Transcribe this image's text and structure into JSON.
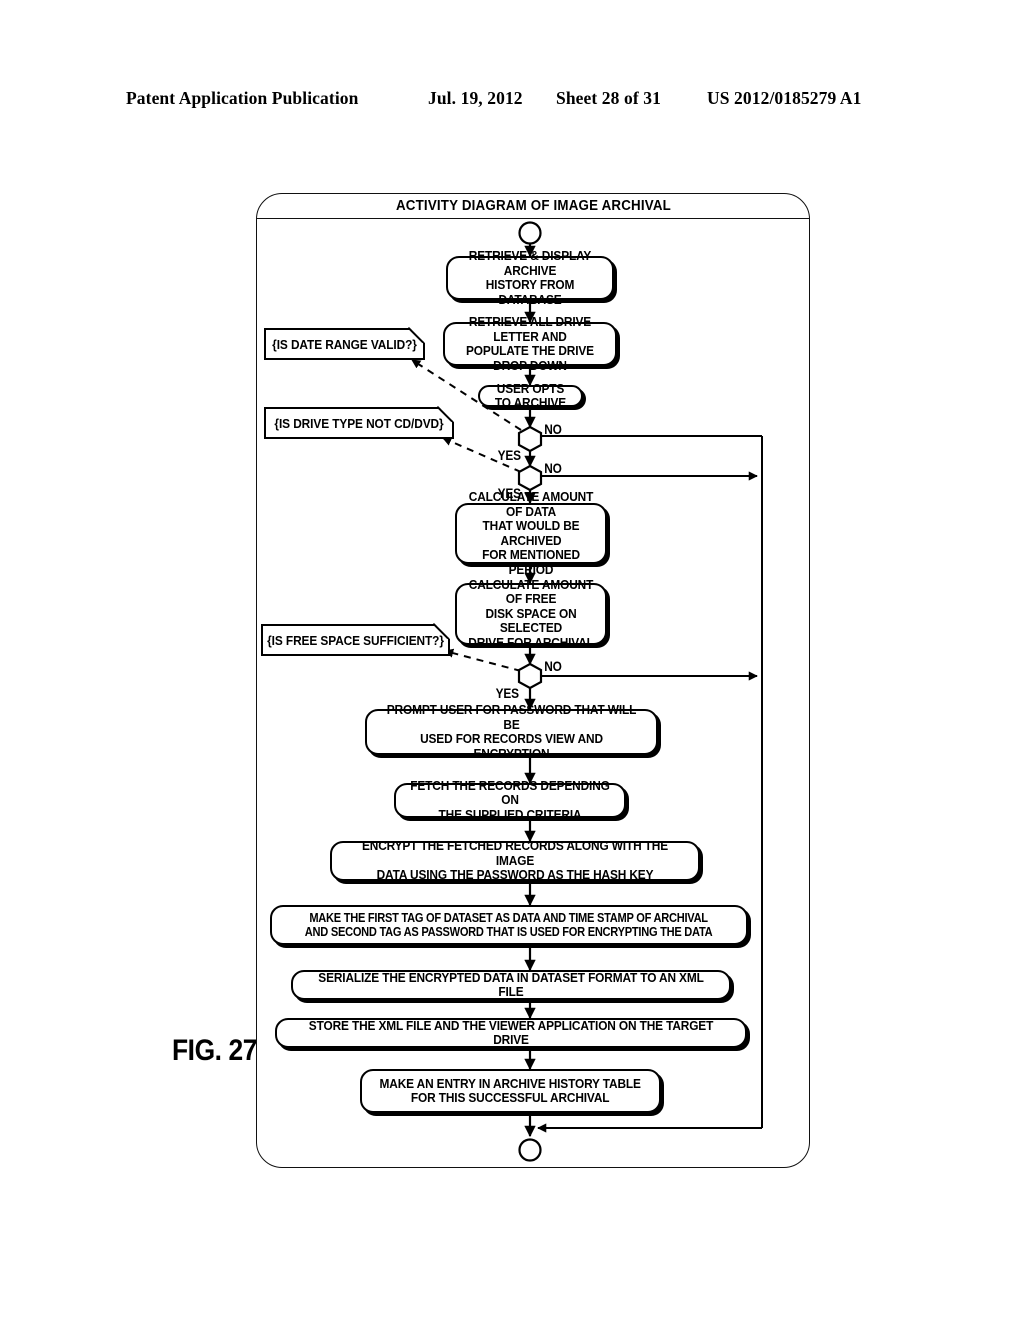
{
  "header": {
    "publication": "Patent Application Publication",
    "date": "Jul. 19, 2012",
    "sheet": "Sheet 28 of 31",
    "number": "US 2012/0185279 A1"
  },
  "figure": {
    "label": "FIG. 27"
  },
  "diagram": {
    "title": "ACTIVITY DIAGRAM OF IMAGE ARCHIVAL",
    "type": "uml-activity-diagram",
    "start_node": "initial-node",
    "end_node": "final-node",
    "activities": [
      {
        "id": "a1",
        "text": "RETRIEVE & DISPLAY ARCHIVE\nHISTORY FROM DATABASE"
      },
      {
        "id": "a2",
        "text": "RETRIEVE ALL DRIVE LETTER AND\nPOPULATE THE DRIVE DROP DOWN"
      },
      {
        "id": "a3",
        "text": "USER OPTS TO ARCHIVE"
      },
      {
        "id": "a4",
        "text": "CALCULATE AMOUNT OF DATA\nTHAT WOULD BE ARCHIVED\nFOR MENTIONED PERIOD"
      },
      {
        "id": "a5",
        "text": "CALCULATE AMOUNT OF FREE\nDISK SPACE ON SELECTED\nDRIVE FOR ARCHIVAL"
      },
      {
        "id": "a6",
        "text": "PROMPT USER FOR PASSWORD THAT WILL BE\nUSED FOR RECORDS VIEW AND ENCRYPTION"
      },
      {
        "id": "a7",
        "text": "FETCH THE RECORDS DEPENDING ON\nTHE SUPPLIED CRITERIA"
      },
      {
        "id": "a8",
        "text": "ENCRYPT THE FETCHED RECORDS ALONG WITH THE IMAGE\nDATA USING THE PASSWORD AS THE HASH KEY"
      },
      {
        "id": "a9",
        "text": "MAKE THE FIRST TAG OF DATASET AS DATA AND TIME STAMP OF ARCHIVAL\nAND SECOND TAG AS PASSWORD THAT IS USED FOR ENCRYPTING THE DATA"
      },
      {
        "id": "a10",
        "text": "SERIALIZE THE ENCRYPTED DATA IN DATASET FORMAT TO AN XML FILE"
      },
      {
        "id": "a11",
        "text": "STORE THE XML FILE AND THE VIEWER APPLICATION ON THE TARGET DRIVE"
      },
      {
        "id": "a12",
        "text": "MAKE AN ENTRY IN ARCHIVE HISTORY TABLE\nFOR THIS SUCCESSFUL ARCHIVAL"
      }
    ],
    "decisions": [
      {
        "id": "d1",
        "note": "n1",
        "yes_label": "YES",
        "no_label": "NO"
      },
      {
        "id": "d2",
        "note": "n2",
        "yes_label": "YES",
        "no_label": "NO"
      },
      {
        "id": "d3",
        "note": "n3",
        "yes_label": "YES",
        "no_label": "NO"
      }
    ],
    "notes": [
      {
        "id": "n1",
        "text": "{IS DATE RANGE VALID?}"
      },
      {
        "id": "n2",
        "text": "{IS DRIVE TYPE NOT CD/DVD}"
      },
      {
        "id": "n3",
        "text": "{IS FREE SPACE SUFFICIENT?}"
      }
    ],
    "branch_labels": {
      "d1_no": "NO",
      "d1_yes": "YES",
      "d2_no": "NO",
      "d2_yes": "YES",
      "d3_no": "NO",
      "d3_yes": "YES"
    },
    "colors": {
      "ink": "#000000",
      "paper": "#ffffff"
    }
  }
}
